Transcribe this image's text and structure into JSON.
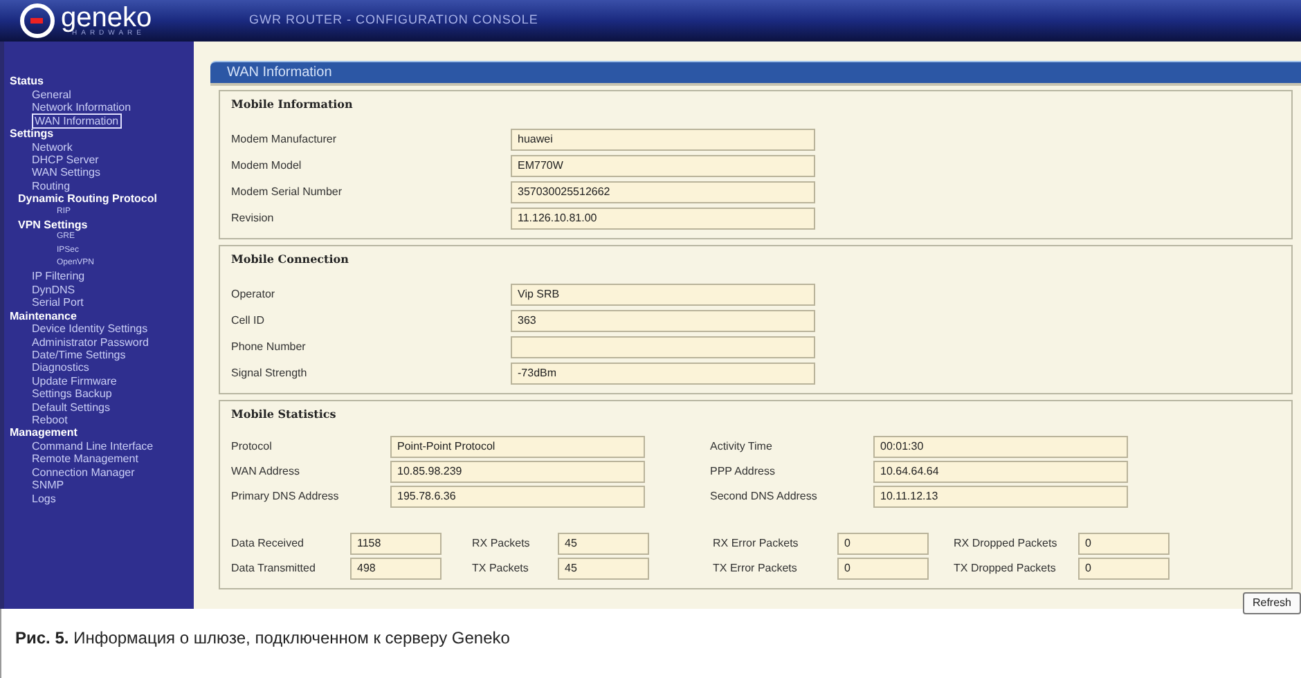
{
  "header": {
    "logo_name": "geneko",
    "logo_sub": "HARDWARE",
    "title": "GWR ROUTER - CONFIGURATION CONSOLE"
  },
  "sidebar": {
    "sections": [
      {
        "label": "Status",
        "children": [
          {
            "label": "General",
            "selected": false
          },
          {
            "label": "Network Information",
            "selected": false
          },
          {
            "label": "WAN Information",
            "selected": true
          }
        ]
      },
      {
        "label": "Settings",
        "children": [
          {
            "label": "Network",
            "selected": false
          },
          {
            "label": "DHCP Server",
            "selected": false
          },
          {
            "label": "WAN Settings",
            "selected": false
          },
          {
            "label": "Routing",
            "selected": false
          },
          {
            "label": "Dynamic Routing Protocol",
            "kind": "group",
            "selected": false,
            "children": [
              {
                "label": "RIP",
                "selected": false
              }
            ]
          },
          {
            "label": "VPN Settings",
            "kind": "group",
            "selected": false,
            "children": [
              {
                "label": "GRE",
                "selected": false
              },
              {
                "label": "IPSec",
                "selected": false
              },
              {
                "label": "OpenVPN",
                "selected": false
              }
            ]
          },
          {
            "label": "IP Filtering",
            "selected": false
          },
          {
            "label": "DynDNS",
            "selected": false
          },
          {
            "label": "Serial Port",
            "selected": false
          }
        ]
      },
      {
        "label": "Maintenance",
        "children": [
          {
            "label": "Device Identity Settings",
            "selected": false
          },
          {
            "label": "Administrator Password",
            "selected": false
          },
          {
            "label": "Date/Time Settings",
            "selected": false
          },
          {
            "label": "Diagnostics",
            "selected": false
          },
          {
            "label": "Update Firmware",
            "selected": false
          },
          {
            "label": "Settings Backup",
            "selected": false
          },
          {
            "label": "Default Settings",
            "selected": false
          },
          {
            "label": "Reboot",
            "selected": false
          }
        ]
      },
      {
        "label": "Management",
        "children": [
          {
            "label": "Command Line Interface",
            "selected": false
          },
          {
            "label": "Remote Management",
            "selected": false
          },
          {
            "label": "Connection Manager",
            "selected": false
          },
          {
            "label": "SNMP",
            "selected": false
          },
          {
            "label": "Logs",
            "selected": false
          }
        ]
      }
    ]
  },
  "panel": {
    "title": "WAN Information",
    "mobile_information": {
      "title": "Mobile Information",
      "fields": [
        {
          "label": "Modem Manufacturer",
          "value": "huawei"
        },
        {
          "label": "Modem Model",
          "value": "EM770W"
        },
        {
          "label": "Modem Serial Number",
          "value": "357030025512662"
        },
        {
          "label": "Revision",
          "value": "11.126.10.81.00"
        }
      ]
    },
    "mobile_connection": {
      "title": "Mobile Connection",
      "fields": [
        {
          "label": "Operator",
          "value": "Vip SRB"
        },
        {
          "label": "Cell ID",
          "value": "363"
        },
        {
          "label": "Phone Number"
        },
        {
          "label": "Signal Strength",
          "value": "-73dBm"
        }
      ]
    },
    "mobile_statistics": {
      "title": "Mobile Statistics",
      "address_rows": [
        [
          {
            "label": "Protocol",
            "value": "Point-Point Protocol"
          },
          {
            "label": "Activity Time",
            "value": "00:01:30"
          }
        ],
        [
          {
            "label": "WAN Address",
            "value": "10.85.98.239"
          },
          {
            "label": "PPP Address",
            "value": "10.64.64.64"
          }
        ],
        [
          {
            "label": "Primary DNS Address",
            "value": "195.78.6.36"
          },
          {
            "label": "Second DNS Address",
            "value": "10.11.12.13"
          }
        ]
      ],
      "counter_rows": [
        [
          {
            "label": "Data Received",
            "value": "1158"
          },
          {
            "label": "RX Packets",
            "value": "45"
          },
          {
            "label": "RX Error Packets",
            "value": "0"
          },
          {
            "label": "RX Dropped Packets",
            "value": "0"
          }
        ],
        [
          {
            "label": "Data Transmitted",
            "value": "498"
          },
          {
            "label": "TX Packets",
            "value": "45"
          },
          {
            "label": "TX Error Packets",
            "value": "0"
          },
          {
            "label": "TX Dropped Packets",
            "value": "0"
          }
        ]
      ]
    },
    "refresh_button": "Refresh"
  },
  "caption": "**Рис. 5.** Информация о шлюзе, подключенном к серверу Geneko"
}
